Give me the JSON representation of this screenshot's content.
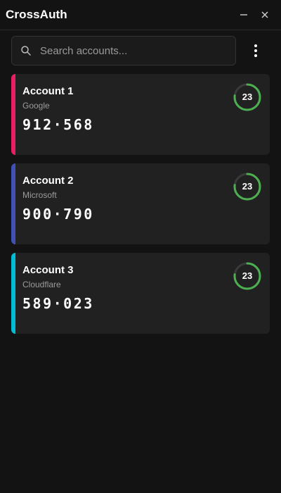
{
  "window": {
    "title": "CrossAuth"
  },
  "search": {
    "placeholder": "Search accounts..."
  },
  "accounts": [
    {
      "name": "Account 1",
      "issuer": "Google",
      "code_part1": "912",
      "code_part2": "568",
      "seconds_remaining": "23",
      "timer_fraction": 0.77,
      "accent_color": "#e91e63"
    },
    {
      "name": "Account 2",
      "issuer": "Microsoft",
      "code_part1": "900",
      "code_part2": "790",
      "seconds_remaining": "23",
      "timer_fraction": 0.77,
      "accent_color": "#3f51b5"
    },
    {
      "name": "Account 3",
      "issuer": "Cloudflare",
      "code_part1": "589",
      "code_part2": "023",
      "seconds_remaining": "23",
      "timer_fraction": 0.77,
      "accent_color": "#00bcd4"
    }
  ],
  "colors": {
    "background": "#131313",
    "card": "#212121",
    "timer_ring": "#4caf50",
    "timer_track": "#3a3a3a"
  },
  "icons": {
    "minimize": "minimize-icon",
    "close": "close-icon",
    "search": "search-icon",
    "menu": "more-vert-icon"
  }
}
